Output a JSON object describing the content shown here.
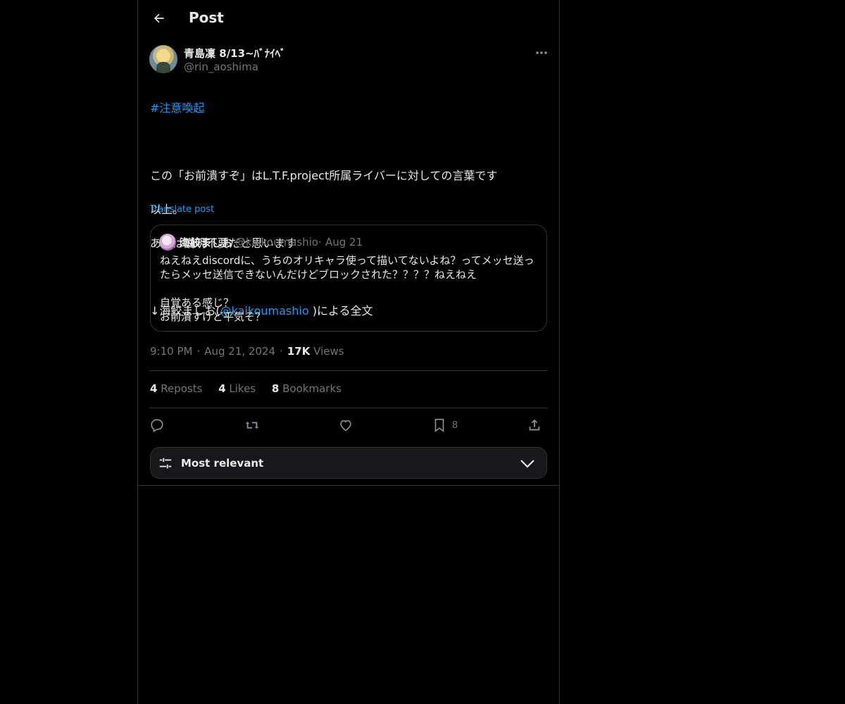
{
  "header": {
    "title": "Post"
  },
  "post": {
    "display_name": "青島凜 8/13~ﾊﾞﾅｲﾍﾞ",
    "handle": "@rin_aoshima",
    "hashtag": "#注意喚起",
    "line1": "この「お前潰すぞ」はL.T.F.project所属ライバーに対しての言葉です",
    "line2": "以上。",
    "line3": "あとは説明不要だと思います",
    "line4_prefix": "↓海鮫ましお(",
    "line4_mention": "@kaikoumashio",
    "line4_suffix": " )による全文",
    "translate": "Translate post",
    "time": "9:10 PM",
    "date": "Aug 21, 2024",
    "views_count": "17K",
    "views_label": "Views"
  },
  "quote": {
    "name": "海鮫ましお",
    "handle": "@kaikoumashio",
    "dot": "·",
    "date": "Aug 21",
    "line1": "ねえねえdiscordに、うちのオリキャラ使って描いてないよね？ってメッセ送っ",
    "line2": "たらメッセ送信できないんだけどブロックされた？？？？ねえねえ",
    "line3": "自覚ある感じ？",
    "line4": "お前潰すけど平気そ？"
  },
  "meta_dot": "·",
  "stats": {
    "reposts_count": "4",
    "reposts_label": "Reposts",
    "likes_count": "4",
    "likes_label": "Likes",
    "bookmarks_count": "8",
    "bookmarks_label": "Bookmarks"
  },
  "actions": {
    "bookmark_count": "8"
  },
  "sort": {
    "label": "Most relevant"
  },
  "icons": {
    "back": "back-arrow-icon",
    "more": "more-icon",
    "reply": "reply-icon",
    "repost": "repost-icon",
    "like": "heart-icon",
    "bookmark": "bookmark-icon",
    "share": "share-icon",
    "sort": "sliders-icon",
    "chevron": "chevron-down-icon"
  },
  "colors": {
    "link": "#1d9bf0",
    "border": "#2f3336",
    "muted": "#71767b",
    "text": "#e7e9ea"
  }
}
